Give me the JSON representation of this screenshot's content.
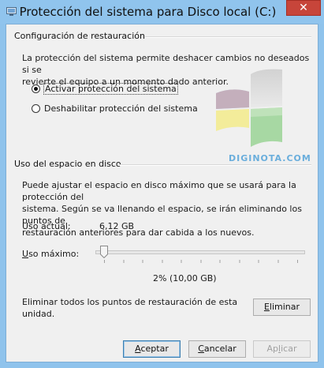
{
  "window": {
    "title": "Protección del sistema para Disco local (C:)",
    "close_symbol": "✕"
  },
  "restore": {
    "group_title": "Configuración de restauración",
    "description_line1": "La protección del sistema permite deshacer cambios no deseados si se",
    "description_line2": "revierte el equipo a un momento dado anterior.",
    "option_enable": "Activar protección del sistema",
    "option_disable": "Deshabilitar protección del sistema",
    "selected": "option_enable"
  },
  "watermark": "DIGINOTA.COM",
  "disk": {
    "group_title": "Uso del espacio en disco",
    "description_line1": "Puede ajustar el espacio en disco máximo que se usará para la protección del",
    "description_line2": "sistema. Según se va llenando el espacio, se irán eliminando los puntos de",
    "description_line3": "restauración anteriores para dar cabida a los nuevos.",
    "current_label": "Uso actual:",
    "current_value": "6,12 GB",
    "max_label_u": "U",
    "max_label_rest": "so máximo:",
    "max_value": "2% (10,00 GB)",
    "max_fraction": 0.02,
    "delete_line1": "Eliminar todos los puntos de restauración de esta",
    "delete_line2": "unidad.",
    "delete_button_u": "E",
    "delete_button_rest": "liminar"
  },
  "buttons": {
    "ok_u": "A",
    "ok_rest": "ceptar",
    "cancel_u": "C",
    "cancel_rest": "ancelar",
    "apply_pre": "Ap",
    "apply_u": "l",
    "apply_rest": "icar"
  },
  "colors": {
    "title_bar": "#90c4ed",
    "close_button": "#c7453a",
    "client_bg": "#f0f0f0"
  },
  "icons": {
    "app": "computer-icon",
    "shield": "windows-shield-icon"
  }
}
